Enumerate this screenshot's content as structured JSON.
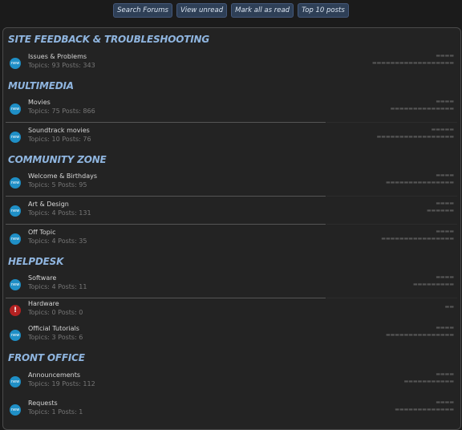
{
  "toolbar": {
    "search": "Search Forums",
    "unread": "View unread",
    "mark": "Mark all as read",
    "top": "Top 10 posts"
  },
  "categories": [
    {
      "title": "SITE FEEDBACK & TROUBLESHOOTING"
    },
    {
      "title": "MULTIMEDIA"
    },
    {
      "title": "COMMUNITY ZONE"
    },
    {
      "title": "HELPDESK"
    },
    {
      "title": "FRONT OFFICE"
    }
  ],
  "forums": [
    {
      "name": "Issues & Problems",
      "stats": "Topics: 93 Posts: 343",
      "icon": "forum-icon"
    },
    {
      "name": "Movies",
      "stats": "Topics: 75 Posts: 866",
      "icon": "forum-icon"
    },
    {
      "name": "Soundtrack movies",
      "stats": "Topics: 10 Posts: 76",
      "icon": "forum-icon"
    },
    {
      "name": "Welcome & Birthdays",
      "stats": "Topics: 5 Posts: 95",
      "icon": "forum-icon"
    },
    {
      "name": "Art & Design",
      "stats": "Topics: 4 Posts: 131",
      "icon": "forum-icon"
    },
    {
      "name": "Off Topic",
      "stats": "Topics: 4 Posts: 35",
      "icon": "forum-icon"
    },
    {
      "name": "Software",
      "stats": "Topics: 4 Posts: 11",
      "icon": "forum-icon"
    },
    {
      "name": "Hardware",
      "stats": "Topics: 0 Posts: 0",
      "icon": "locked-forum-icon"
    },
    {
      "name": "Official Tutorials",
      "stats": "Topics: 3 Posts: 6",
      "icon": "forum-icon"
    },
    {
      "name": "Announcements",
      "stats": "Topics: 19 Posts: 112",
      "icon": "forum-icon"
    },
    {
      "name": "Requests",
      "stats": "Topics: 1 Posts: 1",
      "icon": "forum-icon"
    }
  ],
  "colors": {
    "accent": "#8fb5df",
    "forum_icon": "#1f8fc6",
    "locked_icon": "#b32121"
  }
}
